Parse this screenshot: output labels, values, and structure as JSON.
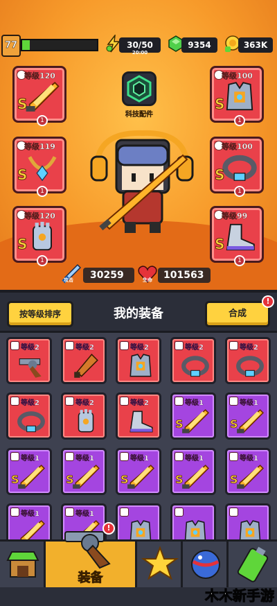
{
  "topbar": {
    "player_level": "77",
    "xp_fraction": 0.1,
    "energy": "30/50",
    "energy_timer": "20:00",
    "gems": "9354",
    "coins": "363K"
  },
  "hero": {
    "tech_label": "科技配件",
    "attack_label": "攻击",
    "attack_value": "30259",
    "hp_label": "生命",
    "hp_value": "101563"
  },
  "slots": [
    {
      "level": "等级120",
      "grade": "S",
      "stars": "1",
      "item": "sword-icon"
    },
    {
      "level": "等级119",
      "grade": "S",
      "stars": "1",
      "item": "necklace-icon"
    },
    {
      "level": "等级120",
      "grade": "S",
      "stars": "1",
      "item": "gauntlet-icon"
    },
    {
      "level": "等级100",
      "grade": "S",
      "stars": "1",
      "item": "armor-icon"
    },
    {
      "level": "等级100",
      "grade": "S",
      "stars": "1",
      "item": "belt-icon"
    },
    {
      "level": "等级99",
      "grade": "S",
      "stars": "1",
      "item": "boots-icon"
    }
  ],
  "header": {
    "sort_label": "按等级排序",
    "title": "我的装备",
    "merge_label": "合成",
    "merge_alert": "!"
  },
  "inventory": [
    {
      "level": "等级2",
      "color": "red",
      "item": "revolver-icon",
      "grade": ""
    },
    {
      "level": "等级2",
      "color": "red",
      "item": "club-icon",
      "grade": ""
    },
    {
      "level": "等级2",
      "color": "red",
      "item": "vest-icon",
      "grade": ""
    },
    {
      "level": "等级2",
      "color": "red",
      "item": "spiked-collar-icon",
      "grade": ""
    },
    {
      "level": "等级2",
      "color": "red",
      "item": "belt-icon",
      "grade": ""
    },
    {
      "level": "等级2",
      "color": "red",
      "item": "belt-icon",
      "grade": ""
    },
    {
      "level": "等级2",
      "color": "red",
      "item": "glove-icon",
      "grade": ""
    },
    {
      "level": "等级2",
      "color": "red",
      "item": "sneaker-icon",
      "grade": ""
    },
    {
      "level": "等级1",
      "color": "purple",
      "item": "sword-icon",
      "grade": "S"
    },
    {
      "level": "等级1",
      "color": "purple",
      "item": "sword-icon",
      "grade": "S"
    },
    {
      "level": "等级1",
      "color": "purple",
      "item": "sword-icon",
      "grade": "S"
    },
    {
      "level": "等级1",
      "color": "purple",
      "item": "sword-icon",
      "grade": "S"
    },
    {
      "level": "等级1",
      "color": "purple",
      "item": "sword-icon",
      "grade": "S"
    },
    {
      "level": "等级1",
      "color": "purple",
      "item": "sword-icon",
      "grade": "S"
    },
    {
      "level": "等级1",
      "color": "purple",
      "item": "sword-icon",
      "grade": "S"
    },
    {
      "level": "等级1",
      "color": "purple",
      "item": "sword-icon",
      "grade": ""
    },
    {
      "level": "等级1",
      "color": "purple",
      "item": "sword-icon",
      "grade": ""
    },
    {
      "level": "",
      "color": "purple",
      "item": "armor-icon",
      "grade": ""
    },
    {
      "level": "",
      "color": "purple",
      "item": "armor-icon",
      "grade": ""
    },
    {
      "level": "",
      "color": "purple",
      "item": "armor-icon",
      "grade": ""
    }
  ],
  "nav": {
    "equip_label": "装备",
    "equip_alert": "!",
    "items": [
      "shop-icon",
      "revolver-icon",
      "star-icon",
      "ball-icon",
      "battery-icon"
    ]
  },
  "watermark": "木木新手游",
  "colors": {
    "slot_red": "#e9414a",
    "slot_purple": "#a445e0",
    "accent_yellow": "#ffd23f",
    "hero_orange": "#f79a2a"
  }
}
